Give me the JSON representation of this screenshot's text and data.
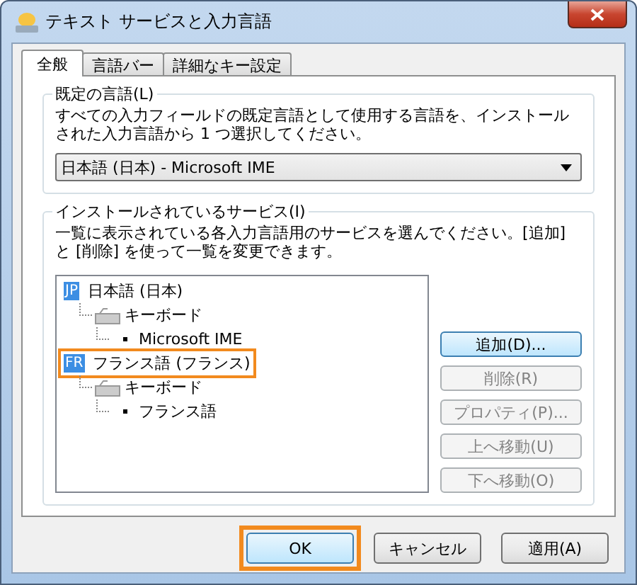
{
  "window": {
    "title": "テキスト サービスと入力言語"
  },
  "tabs": [
    {
      "label": "全般",
      "selected": true
    },
    {
      "label": "言語バー",
      "selected": false
    },
    {
      "label": "詳細なキー設定",
      "selected": false
    }
  ],
  "default_language": {
    "title": "既定の言語(L)",
    "description": "すべての入力フィールドの既定言語として使用する言語を、インストールされた入力言語から 1 つ選択してください。",
    "value": "日本語 (日本) - Microsoft IME"
  },
  "installed_services": {
    "title": "インストールされているサービス(I)",
    "description": "一覧に表示されている各入力言語用のサービスを選んでください。[追加] と [削除] を使って一覧を変更できます。",
    "tree": [
      {
        "kind": "language",
        "badge": "JP",
        "label": "日本語 (日本)",
        "highlighted": false,
        "children": [
          {
            "kind": "category",
            "label": "キーボード",
            "children": [
              {
                "kind": "service",
                "label": "Microsoft IME"
              }
            ]
          }
        ]
      },
      {
        "kind": "language",
        "badge": "FR",
        "label": "フランス語 (フランス)",
        "highlighted": true,
        "children": [
          {
            "kind": "category",
            "label": "キーボード",
            "children": [
              {
                "kind": "service",
                "label": "フランス語"
              }
            ]
          }
        ]
      }
    ],
    "buttons": [
      {
        "label": "追加(D)...",
        "disabled": false,
        "default": true
      },
      {
        "label": "削除(R)",
        "disabled": true,
        "default": false
      },
      {
        "label": "プロパティ(P)...",
        "disabled": true,
        "default": false
      },
      {
        "label": "上へ移動(U)",
        "disabled": true,
        "default": false
      },
      {
        "label": "下へ移動(O)",
        "disabled": true,
        "default": false
      }
    ]
  },
  "footer_buttons": [
    {
      "label": "OK",
      "default": true,
      "highlighted": true
    },
    {
      "label": "キャンセル",
      "default": false,
      "highlighted": false
    },
    {
      "label": "適用(A)",
      "default": false,
      "highlighted": false
    }
  ]
}
